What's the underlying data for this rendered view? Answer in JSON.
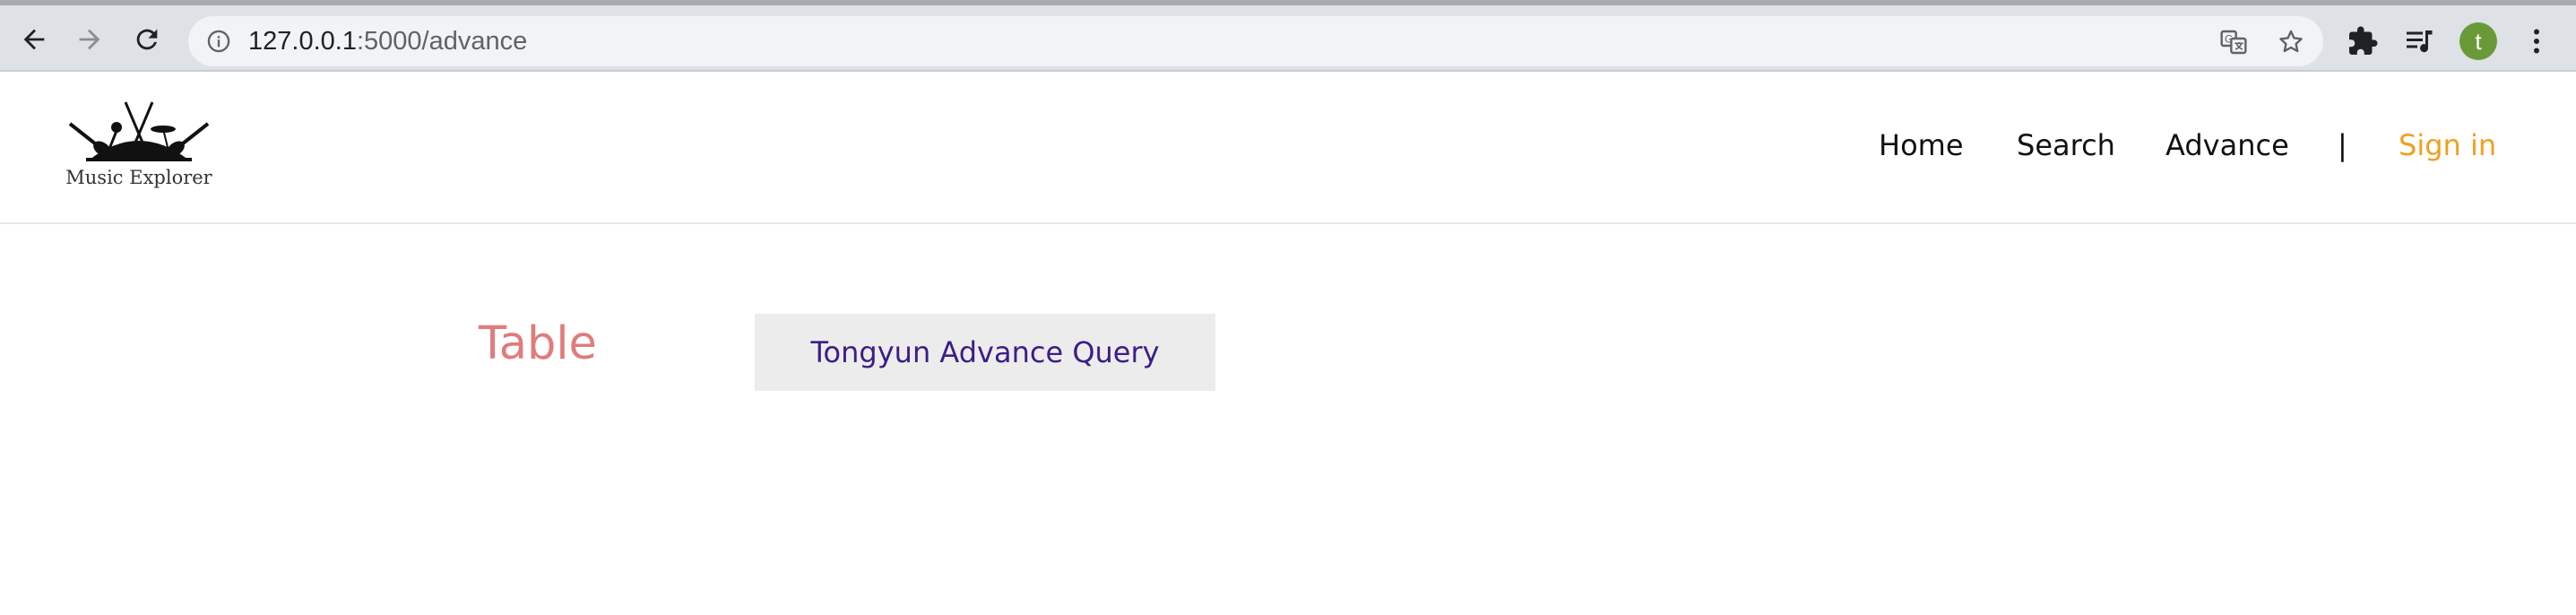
{
  "browser": {
    "url_host": "127.0.0.1",
    "url_path": ":5000/advance",
    "profile_initial": "t",
    "icons": [
      "back-icon",
      "forward-icon",
      "reload-icon",
      "info-icon",
      "translate-icon",
      "bookmark-star-icon",
      "extensions-puzzle-icon",
      "media-queue-icon",
      "kebab-menu-icon"
    ]
  },
  "header": {
    "logo_text": "Music Explorer",
    "nav": {
      "home": "Home",
      "search": "Search",
      "advance": "Advance",
      "divider": "|",
      "sign_in": "Sign in"
    }
  },
  "main": {
    "title": "Table",
    "query_button": "Tongyun Advance Query"
  },
  "colors": {
    "accent_sign_in": "#f0a020",
    "title": "#e07c7c",
    "button_text": "#3d1d86",
    "button_bg": "#ececec"
  }
}
